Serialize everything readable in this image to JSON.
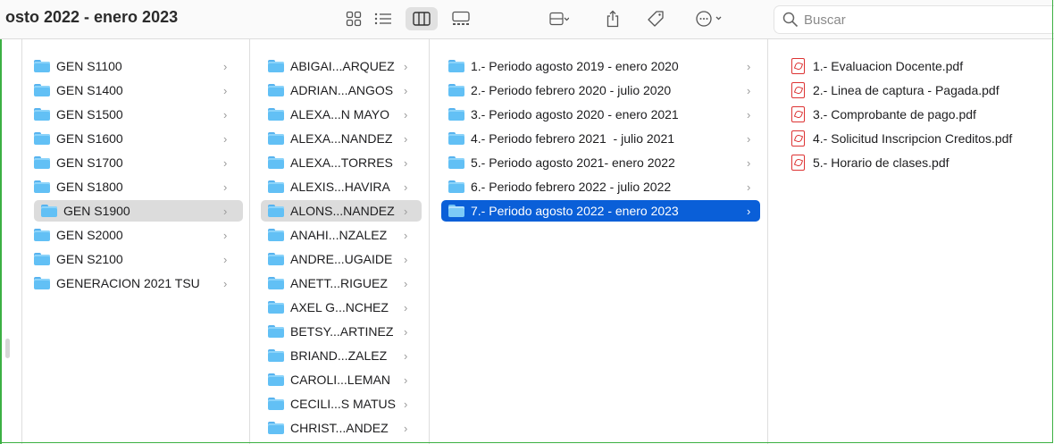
{
  "window": {
    "title": "osto 2022 - enero 2023"
  },
  "search": {
    "placeholder": "Buscar"
  },
  "columns": {
    "gen": [
      "GEN S1100",
      "GEN S1400",
      "GEN S1500",
      "GEN S1600",
      "GEN S1700",
      "GEN S1800",
      "GEN S1900",
      "GEN S2000",
      "GEN S2100",
      "GENERACION 2021 TSU"
    ],
    "students": [
      "ABIGAI...ARQUEZ",
      "ADRIAN...ANGOS",
      "ALEXA...N MAYO",
      "ALEXA...NANDEZ",
      "ALEXA...TORRES",
      "ALEXIS...HAVIRA",
      "ALONS...NANDEZ",
      "ANAHI...NZALEZ",
      "ANDRE...UGAIDE",
      "ANETT...RIGUEZ",
      "AXEL G...NCHEZ",
      "BETSY...ARTINEZ",
      "BRIAND...ZALEZ",
      "CAROLI...LEMAN",
      "CECILI...S MATUS",
      "CHRIST...ANDEZ"
    ],
    "periods": [
      "1.- Periodo agosto 2019 - enero 2020",
      "2.- Periodo febrero 2020 - julio 2020",
      "3.- Periodo agosto 2020 - enero 2021",
      "4.- Periodo febrero 2021  - julio 2021",
      "5.- Periodo agosto 2021- enero 2022",
      "6.- Periodo febrero 2022 - julio 2022",
      "7.- Periodo agosto 2022 - enero 2023"
    ],
    "files": [
      "1.- Evaluacion Docente.pdf",
      "2.- Linea de captura - Pagada.pdf",
      "3.- Comprobante de pago.pdf",
      "4.- Solicitud Inscripcion Creditos.pdf",
      "5.- Horario de clases.pdf"
    ]
  },
  "colors": {
    "selection_blue": "#0a5fd8",
    "selection_gray": "#dcdcdc",
    "folder": "#62c0f5",
    "pdf_red": "#dd3333"
  }
}
